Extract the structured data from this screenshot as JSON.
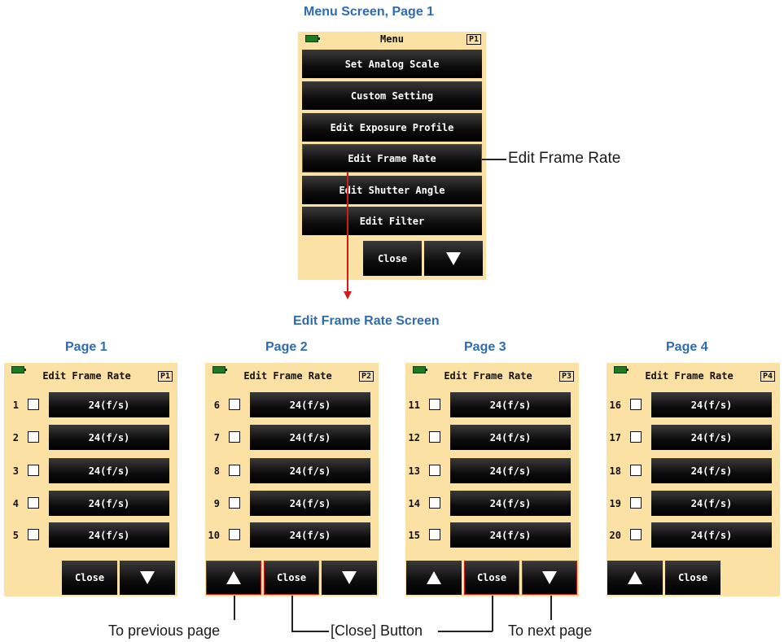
{
  "menu": {
    "heading": "Menu Screen, Page 1",
    "title": "Menu",
    "page_tag": "P1",
    "items": [
      "Set Analog Scale",
      "Custom Setting",
      "Edit Exposure Profile",
      "Edit Frame Rate",
      "Edit Shutter Angle",
      "Edit Filter"
    ],
    "close_label": "Close",
    "callout": "Edit Frame Rate"
  },
  "edit_screen": {
    "heading": "Edit Frame Rate Screen",
    "title": "Edit Frame Rate",
    "close_label": "Close",
    "pages": [
      {
        "heading": "Page 1",
        "tag": "P1",
        "rows": [
          "1",
          "2",
          "3",
          "4",
          "5"
        ],
        "values": [
          "24(f/s)",
          "24(f/s)",
          "24(f/s)",
          "24(f/s)",
          "24(f/s)"
        ]
      },
      {
        "heading": "Page 2",
        "tag": "P2",
        "rows": [
          "6",
          "7",
          "8",
          "9",
          "10"
        ],
        "values": [
          "24(f/s)",
          "24(f/s)",
          "24(f/s)",
          "24(f/s)",
          "24(f/s)"
        ]
      },
      {
        "heading": "Page 3",
        "tag": "P3",
        "rows": [
          "11",
          "12",
          "13",
          "14",
          "15"
        ],
        "values": [
          "24(f/s)",
          "24(f/s)",
          "24(f/s)",
          "24(f/s)",
          "24(f/s)"
        ]
      },
      {
        "heading": "Page 4",
        "tag": "P4",
        "rows": [
          "16",
          "17",
          "18",
          "19",
          "20"
        ],
        "values": [
          "24(f/s)",
          "24(f/s)",
          "24(f/s)",
          "24(f/s)",
          "24(f/s)"
        ]
      }
    ]
  },
  "annotations": {
    "previous": "To previous page",
    "close": "[Close] Button",
    "next": "To next page"
  },
  "colors": {
    "screen_bg": "#fbe1a4",
    "heading_blue": "#2e6bb3",
    "highlight_red": "#d11a1a"
  }
}
